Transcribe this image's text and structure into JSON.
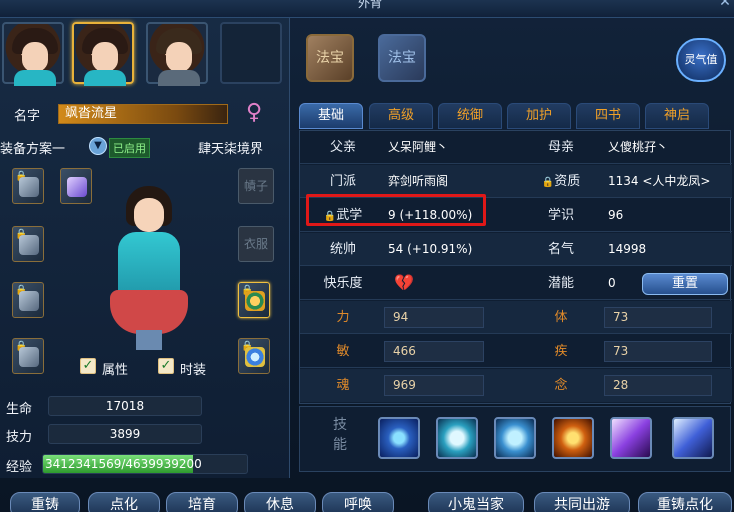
{
  "window": {
    "title": "外背"
  },
  "left": {
    "name_label": "名字",
    "name": "飒沓流星",
    "gender_symbol": "♀",
    "equip_scheme": "装备方案一",
    "enabled_badge": "已启用",
    "realm": "肆天柒境界",
    "headwear_label": "幘子",
    "clothes_label": "衣服",
    "checkbox_attr": "属性",
    "checkbox_fashion": "时装",
    "stats": [
      {
        "label": "生命",
        "value": "17018"
      },
      {
        "label": "技力",
        "value": "3899"
      }
    ],
    "exp_label": "经验",
    "exp_value": "3412341569/4639939200",
    "exp_ratio": 0.7354
  },
  "right": {
    "fabao_1": "法宝",
    "fabao_2": "法宝",
    "lingqi": "灵气值",
    "tabs": [
      "基础",
      "高级",
      "统御",
      "加护",
      "四书",
      "神启"
    ],
    "rows": {
      "father_label": "父亲",
      "father": "乂呆阿鲤丶",
      "mother_label": "母亲",
      "mother": "乂傻桃孖丶",
      "sect_label": "门派",
      "sect": "弈剑听雨阁",
      "aptitude_label": "资质",
      "aptitude": "1134 <人中龙凤>",
      "martial_label": "武学",
      "martial": "9 (+118.00%)",
      "knowledge_label": "学识",
      "knowledge": "96",
      "command_label": "统帅",
      "command": "54 (+10.91%)",
      "fame_label": "名气",
      "fame": "14998",
      "happiness_label": "快乐度",
      "potential_label": "潜能",
      "potential": "0",
      "reset_label": "重置",
      "str_label": "力",
      "str": "94",
      "con_label": "体",
      "con": "73",
      "agi_label": "敏",
      "agi": "466",
      "spd_label": "疾",
      "spd": "73",
      "soul_label": "魂",
      "soul": "969",
      "mind_label": "念",
      "mind": "28"
    },
    "skill_label_1": "技",
    "skill_label_2": "能"
  },
  "bottom_buttons": [
    "重铸",
    "点化",
    "培育",
    "休息",
    "呼唤",
    "小鬼当家",
    "共同出游",
    "重铸点化"
  ]
}
